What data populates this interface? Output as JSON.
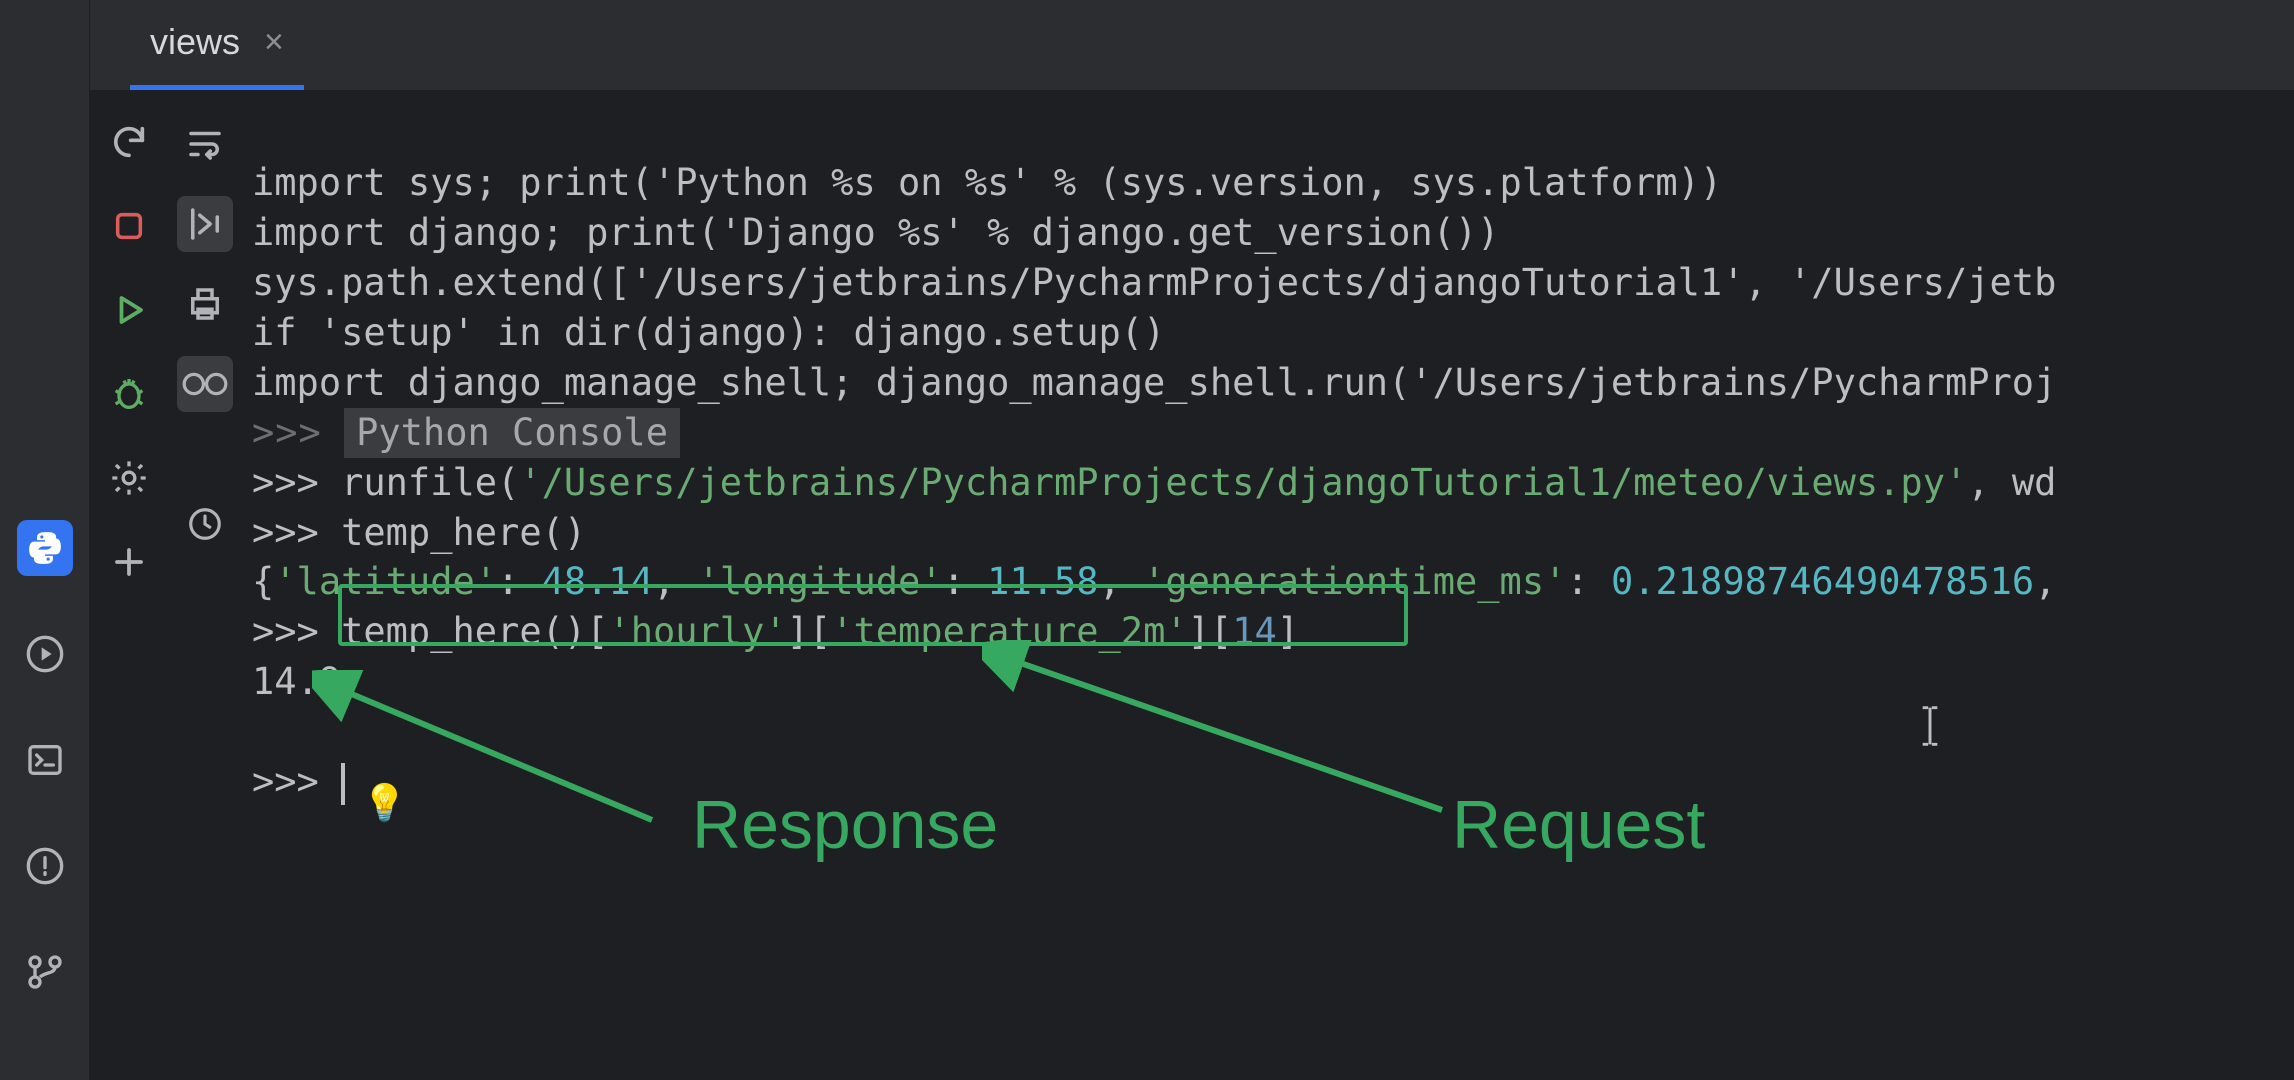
{
  "tab": {
    "label": "views"
  },
  "console": {
    "line1": "import sys; print('Python %s on %s' % (sys.version, sys.platform))",
    "line2": "import django; print('Django %s' % django.get_version())",
    "line3": "sys.path.extend(['/Users/jetbrains/PycharmProjects/djangoTutorial1', '/Users/jetb",
    "line4": "if 'setup' in dir(django): django.setup()",
    "line5": "import django_manage_shell; django_manage_shell.run('/Users/jetbrains/PycharmProj",
    "label": "Python Console",
    "runfile_prefix": "runfile(",
    "runfile_path": "'/Users/jetbrains/PycharmProjects/djangoTutorial1/meteo/views.py'",
    "runfile_suffix": ", wd",
    "call1": "temp_here()",
    "resp1_a": "{",
    "resp1_lat_key": "'latitude'",
    "resp1_lat_val": "48.14",
    "resp1_lon_key": "'longitude'",
    "resp1_lon_val": "11.58",
    "resp1_gen_key": "'generationtime_ms'",
    "resp1_gen_val": "0.21898746490478516",
    "call2_a": "temp_here()[",
    "call2_b": "'hourly'",
    "call2_c": "][",
    "call2_d": "'temperature_2m'",
    "call2_e": "][",
    "call2_f": "14",
    "call2_g": "]",
    "resp2": "14.9",
    "prompt": ">>>"
  },
  "annotations": {
    "response": "Response",
    "request": "Request"
  },
  "colors": {
    "accent": "#3574f0",
    "anno_green": "#36a85f"
  }
}
